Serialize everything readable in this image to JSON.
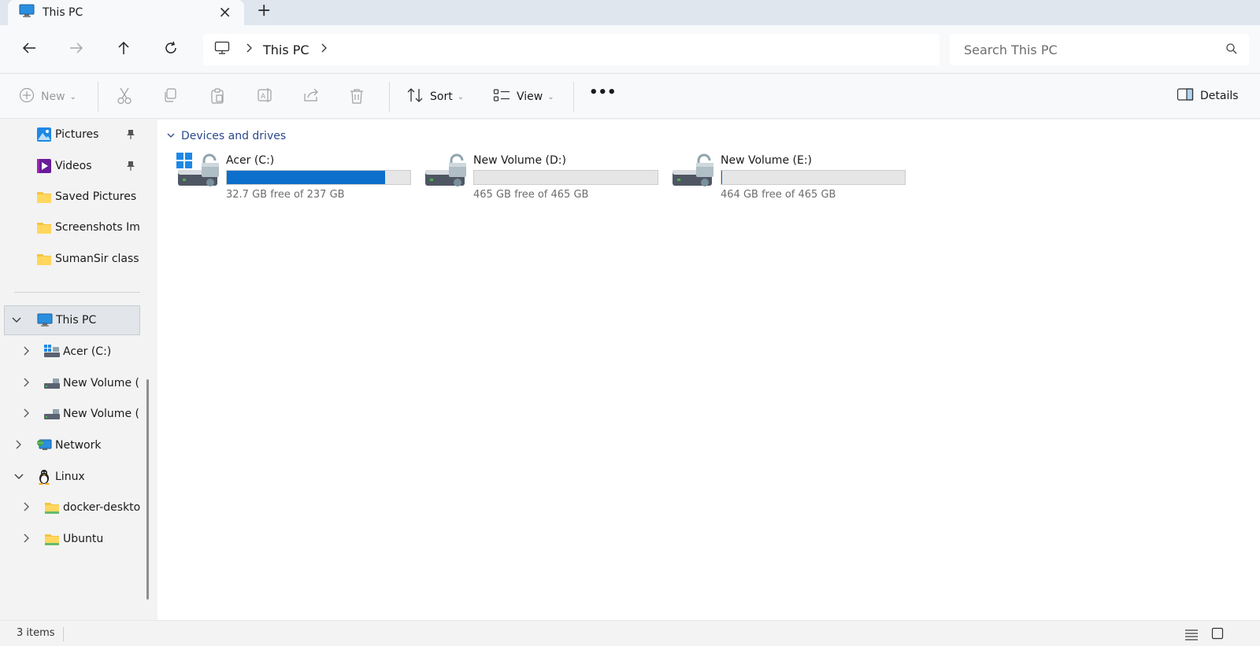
{
  "window": {
    "tab_title": "This PC",
    "tab_icon": "monitor-icon",
    "new_tab_icon": "plus-icon"
  },
  "nav": {
    "back_icon": "arrow-left-icon",
    "forward_icon": "arrow-right-icon",
    "up_icon": "arrow-up-icon",
    "refresh_icon": "refresh-icon",
    "breadcrumb": [
      "This PC"
    ],
    "search_placeholder": "Search This PC"
  },
  "toolbar": {
    "new_label": "New",
    "sort_label": "Sort",
    "view_label": "View",
    "more_label": "•••",
    "details_label": "Details"
  },
  "sidebar": {
    "quick": [
      {
        "label": "Pictures",
        "icon": "pictures-icon",
        "pinned": true
      },
      {
        "label": "Videos",
        "icon": "videos-icon",
        "pinned": true
      },
      {
        "label": "Saved Pictures",
        "icon": "folder-icon",
        "pinned": false
      },
      {
        "label": "Screenshots Ima",
        "icon": "folder-icon",
        "pinned": false
      },
      {
        "label": "SumanSir class a",
        "icon": "folder-icon",
        "pinned": false
      }
    ],
    "this_pc": {
      "label": "This PC",
      "icon": "monitor-icon"
    },
    "drives": [
      {
        "label": "Acer (C:)",
        "icon": "system-drive-icon"
      },
      {
        "label": "New Volume (D",
        "icon": "drive-icon"
      },
      {
        "label": "New Volume (E",
        "icon": "drive-icon"
      }
    ],
    "network": {
      "label": "Network",
      "icon": "network-icon"
    },
    "linux": {
      "label": "Linux",
      "icon": "linux-penguin-icon"
    },
    "linux_children": [
      {
        "label": "docker-deskto",
        "icon": "folder-icon"
      },
      {
        "label": "Ubuntu",
        "icon": "folder-icon"
      }
    ]
  },
  "content": {
    "group_title": "Devices and drives",
    "drives": [
      {
        "name": "Acer (C:)",
        "free_text": "32.7 GB free of 237 GB",
        "used_fraction": 0.862,
        "system": true
      },
      {
        "name": "New Volume (D:)",
        "free_text": "465 GB free of 465 GB",
        "used_fraction": 0.0,
        "system": false
      },
      {
        "name": "New Volume (E:)",
        "free_text": "464 GB free of 465 GB",
        "used_fraction": 0.002,
        "system": false
      }
    ]
  },
  "status": {
    "item_count": "3 items"
  },
  "colors": {
    "accent": "#0b6fcb",
    "folder": "#f4c542",
    "group_header": "#2b4a8c"
  }
}
